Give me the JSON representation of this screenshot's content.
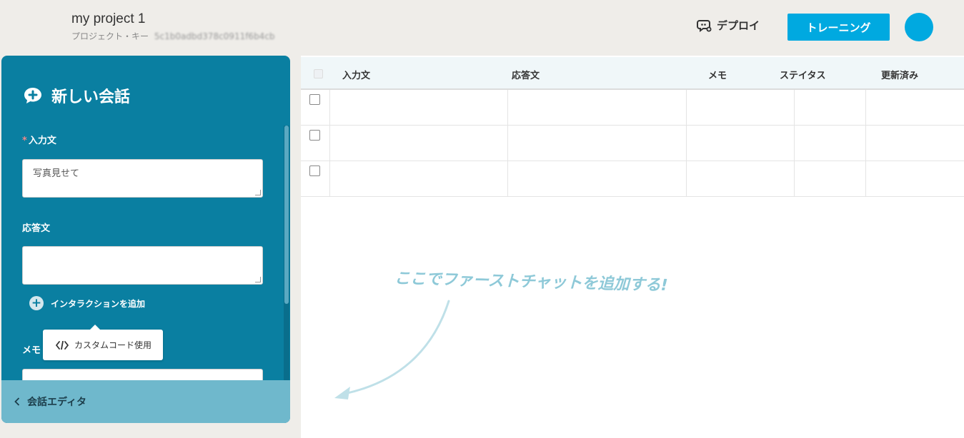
{
  "header": {
    "project_title": "my project 1",
    "project_key_label": "プロジェクト・キー",
    "project_key_value": "5c1b0adbd378c0911f6b4cb",
    "deploy_label": "デプロイ",
    "training_label": "トレーニング"
  },
  "panel": {
    "title": "新しい会話",
    "input_label": "入力文",
    "input_value": "写真見せて",
    "response_label": "応答文",
    "response_value": "",
    "add_interaction_label": "インタラクションを追加",
    "custom_code_label": "カスタムコード使用",
    "memo_label": "メモ",
    "footer_label": "会話エディタ"
  },
  "table": {
    "headers": [
      "入力文",
      "応答文",
      "メモ",
      "ステイタス",
      "更新済み"
    ],
    "rows": [
      [
        "",
        "",
        "",
        "",
        ""
      ],
      [
        "",
        "",
        "",
        "",
        ""
      ],
      [
        "",
        "",
        "",
        "",
        ""
      ]
    ]
  },
  "hint_text": "ここでファーストチャットを追加する!",
  "colors": {
    "panel_bg": "#0a7fa1",
    "accent": "#00a9e0",
    "footer_bg": "#6fb8cc",
    "hint": "#8ec9d8"
  }
}
